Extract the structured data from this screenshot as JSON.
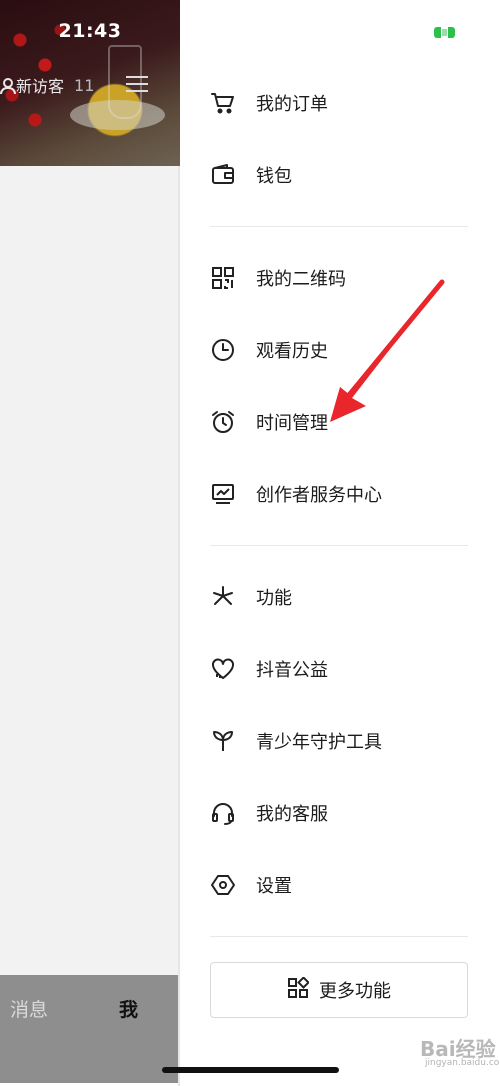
{
  "status_bar": {
    "time": "21:43"
  },
  "profile": {
    "visitor_label": "新访客",
    "visitor_count": "11"
  },
  "bottom_nav": {
    "messages": "消息",
    "me": "我"
  },
  "drawer": {
    "section1": [
      {
        "label": "我的订单",
        "icon": "cart-icon"
      },
      {
        "label": "钱包",
        "icon": "wallet-icon"
      }
    ],
    "section2": [
      {
        "label": "我的二维码",
        "icon": "qrcode-icon"
      },
      {
        "label": "观看历史",
        "icon": "clock-icon"
      },
      {
        "label": "时间管理",
        "icon": "alarm-clock-icon"
      },
      {
        "label": "创作者服务中心",
        "icon": "chart-monitor-icon"
      }
    ],
    "section3": [
      {
        "label": "功能",
        "icon": "asterisk-icon"
      },
      {
        "label": "抖音公益",
        "icon": "heart-icon"
      },
      {
        "label": "青少年守护工具",
        "icon": "sprout-icon"
      },
      {
        "label": "我的客服",
        "icon": "headset-icon"
      },
      {
        "label": "设置",
        "icon": "gear-icon"
      }
    ],
    "more_button": "更多功能"
  },
  "watermark": {
    "text": "Bai经验",
    "sub": "jingyan.baidu.com"
  },
  "colors": {
    "accent_arrow": "#e8262b",
    "battery": "#2dbf4c"
  }
}
